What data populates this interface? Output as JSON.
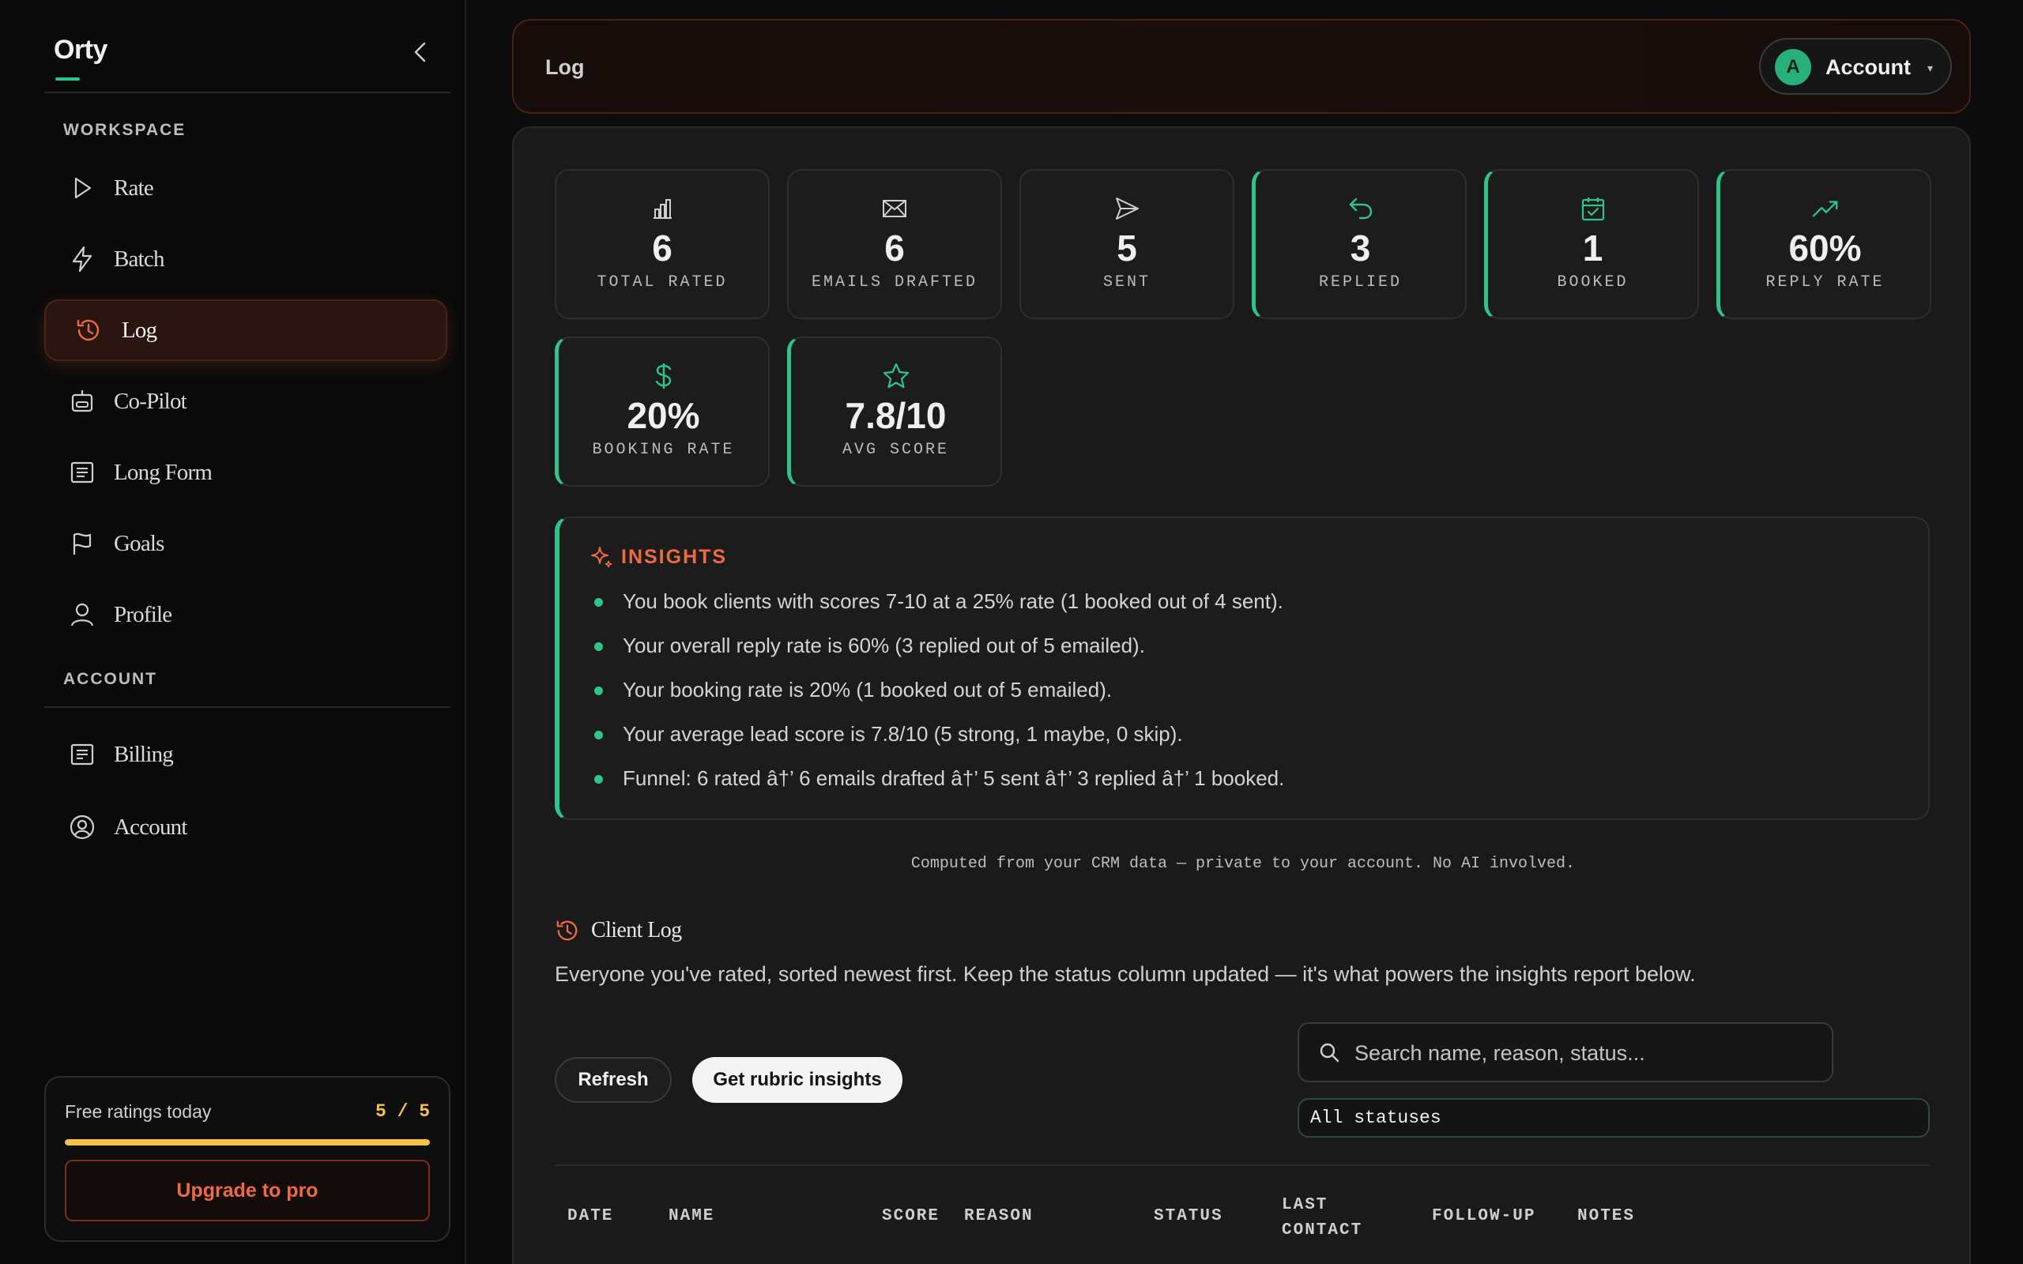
{
  "sidebar": {
    "brand": "Orty",
    "sections": {
      "workspace": "WORKSPACE",
      "account": "ACCOUNT"
    },
    "items": [
      {
        "label": "Rate",
        "icon": "play-icon"
      },
      {
        "label": "Batch",
        "icon": "lightning-icon"
      },
      {
        "label": "Log",
        "icon": "history-icon",
        "active": true
      },
      {
        "label": "Co-Pilot",
        "icon": "robot-icon"
      },
      {
        "label": "Long Form",
        "icon": "document-icon"
      },
      {
        "label": "Goals",
        "icon": "flag-icon"
      },
      {
        "label": "Profile",
        "icon": "user-icon"
      }
    ],
    "account_items": [
      {
        "label": "Billing",
        "icon": "receipt-icon"
      },
      {
        "label": "Account",
        "icon": "user-circle-icon"
      }
    ],
    "quota": {
      "label": "Free ratings today",
      "count": "5 / 5",
      "fraction": 1.0,
      "upgrade_label": "Upgrade to pro"
    }
  },
  "header": {
    "title": "Log",
    "account": {
      "avatar_letter": "A",
      "label": "Account"
    }
  },
  "stats": [
    {
      "value": "6",
      "label": "TOTAL RATED",
      "icon": "bar-chart-icon",
      "accent": false
    },
    {
      "value": "6",
      "label": "EMAILS DRAFTED",
      "icon": "mail-icon",
      "accent": false
    },
    {
      "value": "5",
      "label": "SENT",
      "icon": "send-icon",
      "accent": false
    },
    {
      "value": "3",
      "label": "REPLIED",
      "icon": "reply-icon",
      "accent": true
    },
    {
      "value": "1",
      "label": "BOOKED",
      "icon": "calendar-check-icon",
      "accent": true
    },
    {
      "value": "60%",
      "label": "REPLY RATE",
      "icon": "trending-up-icon",
      "accent": true
    },
    {
      "value": "20%",
      "label": "BOOKING RATE",
      "icon": "dollar-icon",
      "accent": true
    },
    {
      "value": "7.8/10",
      "label": "AVG SCORE",
      "icon": "star-icon",
      "accent": true
    }
  ],
  "insights": {
    "title": "INSIGHTS",
    "items": [
      "You book clients with scores 7-10 at a 25% rate (1 booked out of 4 sent).",
      "Your overall reply rate is 60% (3 replied out of 5 emailed).",
      "Your booking rate is 20% (1 booked out of 5 emailed).",
      "Your average lead score is 7.8/10 (5 strong, 1 maybe, 0 skip).",
      "Funnel: 6 rated â†’ 6 emails drafted â†’ 5 sent â†’ 3 replied â†’ 1 booked."
    ],
    "note": "Computed from your CRM data — private to your account. No AI involved."
  },
  "client_log": {
    "title": "Client Log",
    "description": "Everyone you've rated, sorted newest first. Keep the status column updated — it's what powers the insights report below.",
    "refresh_label": "Refresh",
    "rubric_label": "Get rubric insights",
    "search_placeholder": "Search name, reason, status...",
    "status_filter": "All statuses",
    "columns": [
      "DATE",
      "NAME",
      "SCORE",
      "REASON",
      "STATUS",
      "LAST CONTACT",
      "FOLLOW-UP",
      "NOTES"
    ]
  },
  "colors": {
    "accent_green": "#2ec58a",
    "accent_orange": "#ef6a43",
    "quota_yellow": "#f4c24d"
  }
}
